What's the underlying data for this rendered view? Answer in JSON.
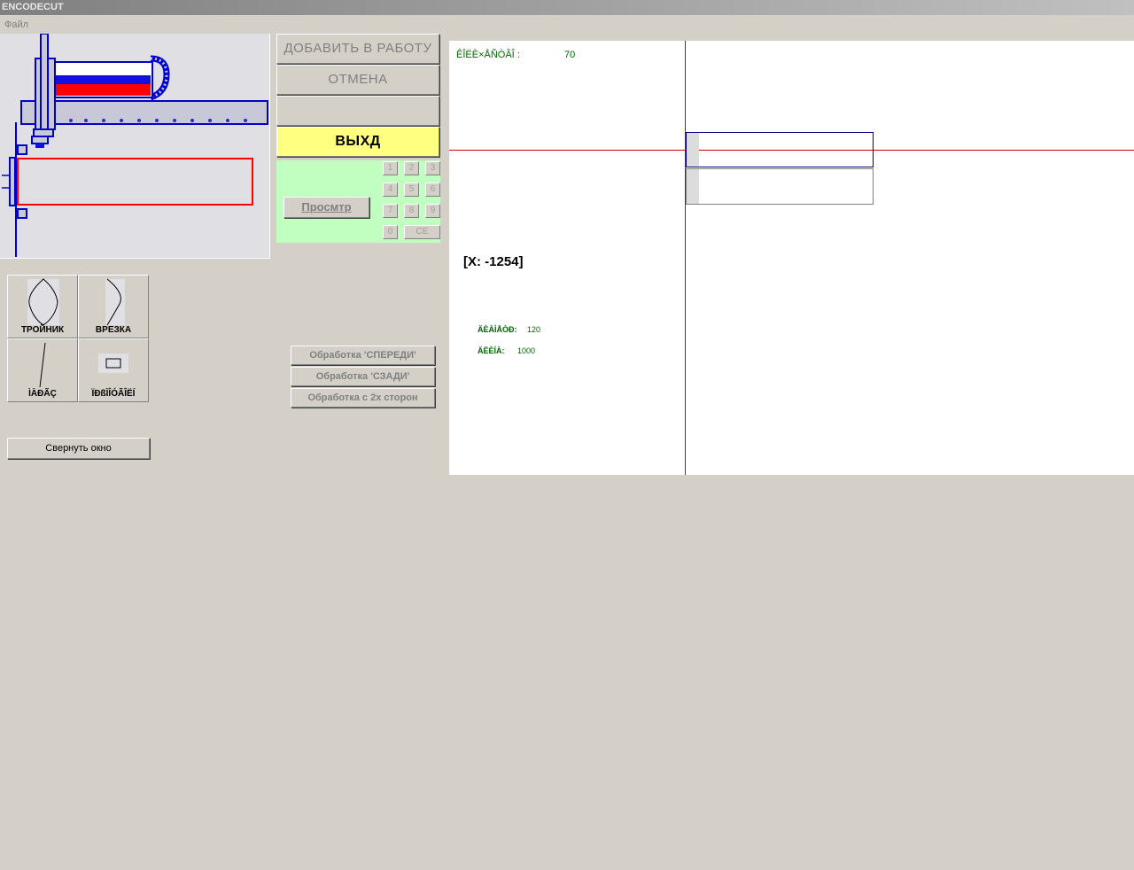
{
  "window": {
    "title": "ENCODECUT"
  },
  "menu": {
    "file": "Файл"
  },
  "buttons": {
    "add_to_work": "ДОБАВИТЬ В РАБОТУ",
    "cancel": "ОТМЕНА",
    "blank": "",
    "exit": "ВЫХД"
  },
  "numpad": {
    "preview": "Просмтр",
    "keys": [
      "1",
      "2",
      "3",
      "4",
      "5",
      "6",
      "7",
      "8",
      "9",
      "0",
      "CE"
    ]
  },
  "shapes": [
    {
      "label": "ТРОЙНИК"
    },
    {
      "label": "ВРЕЗКА"
    },
    {
      "label": "ÌÀÐÃÇ"
    },
    {
      "label": "ÏÐßÌÎÓÃÎËÍ"
    }
  ],
  "collapse": "Свернуть окно",
  "processing": [
    "Обработка 'СПЕРЕДИ'",
    "Обработка 'СЗАДИ'",
    "Обработка с 2х сторон"
  ],
  "canvas": {
    "qty_label": "ÊÎËÈ×ÅÑÒÂÎ :",
    "qty_value": "70",
    "coord": "[X: -1254]",
    "diameter_label": "ÄÈÀÌÅÒÐ:",
    "diameter_value": "120",
    "length_label": "ÄËÈÍÀ:",
    "length_value": "1000"
  },
  "colors": {
    "background": "#d4d0c8",
    "exit_button": "#ffff80",
    "numpad_bg": "#c0ffc0",
    "crosshair": "#cc0000",
    "label_text": "#006600"
  }
}
